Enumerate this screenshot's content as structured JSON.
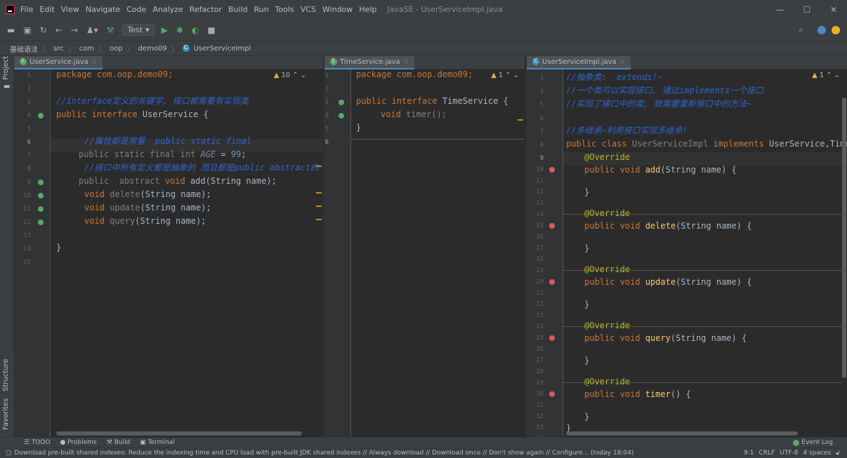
{
  "menu": [
    "File",
    "Edit",
    "View",
    "Navigate",
    "Code",
    "Analyze",
    "Refactor",
    "Build",
    "Run",
    "Tools",
    "VCS",
    "Window",
    "Help"
  ],
  "window_title": "JavaSE - UserServiceImpl.java",
  "toolbar": {
    "run_config": "Test"
  },
  "breadcrumb": [
    "基础语法",
    "src",
    "com",
    "oop",
    "demo09",
    "UserServiceImpl"
  ],
  "left_strip": {
    "project": "Project",
    "structure": "Structure",
    "favorites": "Favorites"
  },
  "panes": {
    "left": {
      "tab": "UserService.java",
      "warnings": "10"
    },
    "middle": {
      "tab": "TimeService.java",
      "warnings": "1"
    },
    "right": {
      "tab": "UserServiceImpl.java",
      "warnings": "1"
    }
  },
  "code_left": {
    "l1": "package com.oop.demo09;",
    "l3": "//interface定义的关键字, 接口都需要有实现类",
    "l4a": "public interface",
    "l4b": " UserService {",
    "l6": "//属性都是常量  public static final",
    "l7a": "public static final int ",
    "l7b": "AGE",
    "l7c": " = ",
    "l7d": "99",
    "l7e": ";",
    "l8": "//接口中所有定义都是抽象的 而且都是public abstract的",
    "l9a": "public  abstract ",
    "l9b": "void ",
    "l9c": "add(String name);",
    "l10a": "void ",
    "l10b": "delete",
    "l10c": "(String name);",
    "l11a": "void ",
    "l11b": "update",
    "l11c": "(String name);",
    "l12a": "void ",
    "l12b": "query",
    "l12c": "(String name);",
    "l14": "}"
  },
  "code_middle": {
    "l1": "package com.oop.demo09;",
    "l3a": "public interface ",
    "l3b": "TimeService {",
    "l4a": "void ",
    "l4b": "timer();",
    "l5": "}"
  },
  "code_right": {
    "l3": "//抽象类:  extends!~",
    "l4": "//一个类可以实现接口, 通过implements一个接口",
    "l5": "//实现了接口中的类, 就需要重新接口中的方法~",
    "l7": "//多继承~利用接口实现多继承!",
    "l8a": "public class ",
    "l8b": "UserServiceImpl ",
    "l8c": "implements ",
    "l8d": "UserService,TimeSe",
    "ann": "@Override",
    "pv": "public void ",
    "add": "add",
    "delete": "delete",
    "update": "update",
    "query": "query",
    "timer": "timer",
    "args": "(String name) {",
    "noargs": "() {",
    "close": "}"
  },
  "bottom_tools": [
    "TODO",
    "Problems",
    "Build",
    "Terminal"
  ],
  "event_log": "Event Log",
  "status": {
    "message": "Download pre-built shared indexes: Reduce the indexing time and CPU load with pre-built JDK shared indexes // Always download // Download once // Don't show again // Configure... (today 18:04)",
    "position": "9:1",
    "line_sep": "CRLF",
    "encoding": "UTF-8",
    "indent": "4 spaces"
  }
}
